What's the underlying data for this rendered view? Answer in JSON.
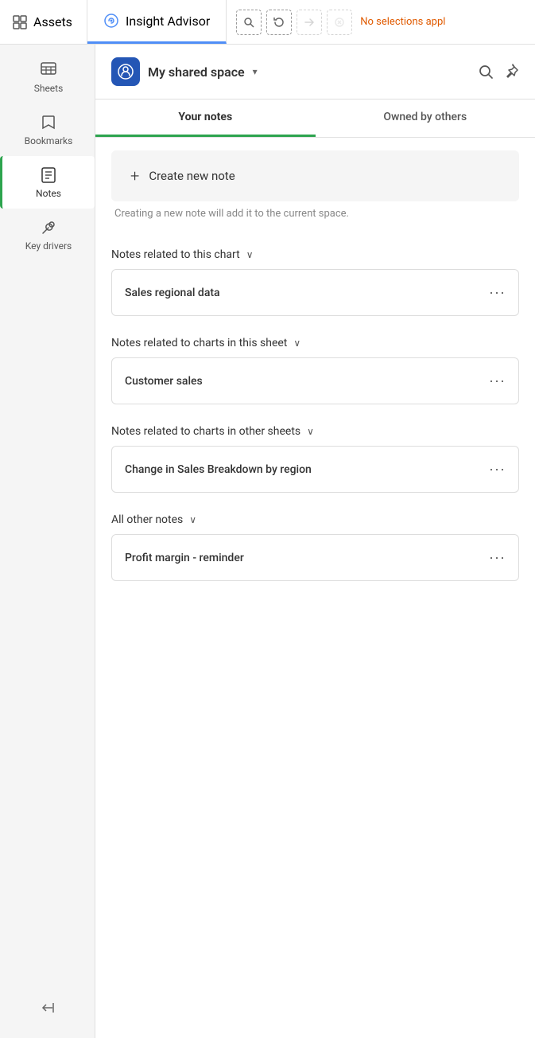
{
  "toolbar": {
    "assets_label": "Assets",
    "insight_label": "Insight Advisor",
    "no_selections_label": "No selections appl"
  },
  "sidebar": {
    "items": [
      {
        "id": "sheets",
        "label": "Sheets",
        "icon": "sheets-icon"
      },
      {
        "id": "bookmarks",
        "label": "Bookmarks",
        "icon": "bookmarks-icon"
      },
      {
        "id": "notes",
        "label": "Notes",
        "icon": "notes-icon",
        "active": true
      },
      {
        "id": "key-drivers",
        "label": "Key drivers",
        "icon": "key-drivers-icon"
      }
    ],
    "collapse_icon": "collapse-left-icon"
  },
  "space_header": {
    "space_name": "My shared space",
    "search_icon": "search-icon",
    "pin_icon": "pin-icon"
  },
  "tabs": [
    {
      "id": "your-notes",
      "label": "Your notes",
      "active": true
    },
    {
      "id": "owned-by-others",
      "label": "Owned by others",
      "active": false
    }
  ],
  "create_note": {
    "label": "Create new note",
    "hint": "Creating a new note will add it to the current space."
  },
  "sections": [
    {
      "id": "related-to-chart",
      "label": "Notes related to this chart",
      "expanded": true,
      "notes": [
        {
          "id": "sales-regional",
          "title": "Sales regional data"
        }
      ]
    },
    {
      "id": "related-to-sheet",
      "label": "Notes related to charts in this sheet",
      "expanded": true,
      "notes": [
        {
          "id": "customer-sales",
          "title": "Customer sales"
        }
      ]
    },
    {
      "id": "related-to-other-sheets",
      "label": "Notes related to charts in other sheets",
      "expanded": true,
      "notes": [
        {
          "id": "change-in-sales",
          "title": "Change in Sales Breakdown by region"
        }
      ]
    },
    {
      "id": "all-other-notes",
      "label": "All other notes",
      "expanded": true,
      "notes": [
        {
          "id": "profit-margin",
          "title": "Profit margin - reminder"
        }
      ]
    }
  ],
  "icons": {
    "menu_dots": "···",
    "plus": "+",
    "chevron_down": "∨",
    "collapse_left": "⊣"
  }
}
